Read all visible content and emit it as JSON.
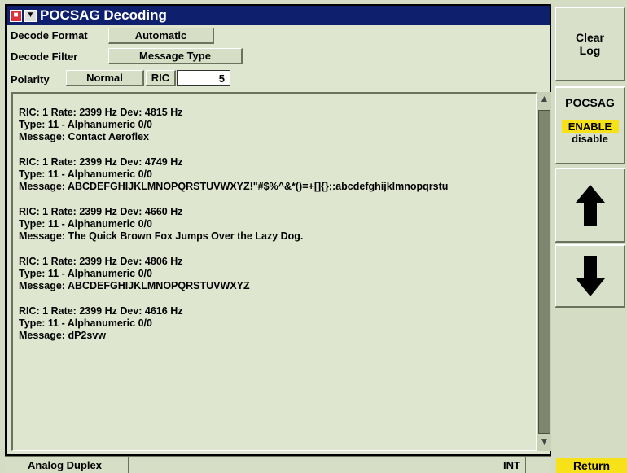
{
  "window": {
    "title": "POCSAG Decoding"
  },
  "settings": {
    "decode_format_label": "Decode Format",
    "decode_format_value": "Automatic",
    "decode_filter_label": "Decode Filter",
    "decode_filter_value": "Message Type",
    "polarity_label": "Polarity",
    "polarity_value": "Normal",
    "ric_label": "RIC",
    "ric_value": "5"
  },
  "log": [
    {
      "line1": "RIC: 1  Rate: 2399 Hz  Dev: 4815 Hz",
      "line2": "Type: 11 - Alphanumeric  0/0",
      "line3": "Message: Contact Aeroflex"
    },
    {
      "line1": "RIC: 1  Rate: 2399 Hz  Dev: 4749 Hz",
      "line2": "Type: 11 - Alphanumeric  0/0",
      "line3": "Message: ABCDEFGHIJKLMNOPQRSTUVWXYZ!\"#$%^&*()=+[]{};:abcdefghijklmnopqrstu"
    },
    {
      "line1": "RIC: 1  Rate: 2399 Hz  Dev: 4660 Hz",
      "line2": "Type: 11 - Alphanumeric  0/0",
      "line3": "Message: The Quick Brown Fox Jumps Over the Lazy Dog."
    },
    {
      "line1": "RIC: 1  Rate: 2399 Hz  Dev: 4806 Hz",
      "line2": "Type: 11 - Alphanumeric  0/0",
      "line3": "Message: ABCDEFGHIJKLMNOPQRSTUVWXYZ"
    },
    {
      "line1": "RIC: 1  Rate: 2399 Hz  Dev: 4616 Hz",
      "line2": "Type: 11 - Alphanumeric  0/0",
      "line3": "Message: dP2svw"
    }
  ],
  "status": {
    "mode": "Analog Duplex",
    "ref": "INT"
  },
  "softkeys": {
    "clear_log_line1": "Clear",
    "clear_log_line2": "Log",
    "pocsag": "POCSAG",
    "enable": "ENABLE",
    "disable": "disable",
    "return": "Return"
  },
  "icons": {
    "up": "arrow-up-icon",
    "down": "arrow-down-icon",
    "menu": "window-menu-icon"
  },
  "colors": {
    "titlebar": "#0e1f6e",
    "highlight": "#f7e21a",
    "background": "#dfe6cf"
  }
}
